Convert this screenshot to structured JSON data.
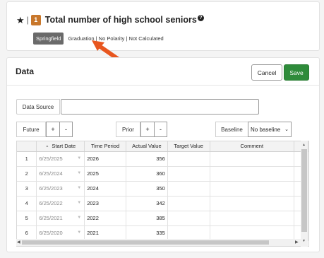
{
  "header": {
    "star_glyph": "★",
    "separator": "|",
    "number_badge": "1",
    "title": "Total number of high school seniors",
    "help_glyph": "?",
    "location_badge": "Springfield",
    "meta_text": "Graduation | No Polarity | Not Calculated"
  },
  "data_section": {
    "title": "Data",
    "cancel_label": "Cancel",
    "save_label": "Save",
    "data_source_label": "Data Source",
    "data_source_value": "",
    "future_label": "Future",
    "prior_label": "Prior",
    "plus_label": "+",
    "minus_label": "-",
    "baseline_label": "Baseline",
    "baseline_value": "No baseline"
  },
  "table": {
    "headers": [
      "",
      "Start Date",
      "Time Period",
      "Actual Value",
      "Target Value",
      "Comment"
    ],
    "rows": [
      {
        "idx": "1",
        "start_date": "6/25/2025",
        "time_period": "2026",
        "actual": "356",
        "target": "",
        "comment": ""
      },
      {
        "idx": "2",
        "start_date": "6/25/2024",
        "time_period": "2025",
        "actual": "360",
        "target": "",
        "comment": ""
      },
      {
        "idx": "3",
        "start_date": "6/25/2023",
        "time_period": "2024",
        "actual": "350",
        "target": "",
        "comment": ""
      },
      {
        "idx": "4",
        "start_date": "6/25/2022",
        "time_period": "2023",
        "actual": "342",
        "target": "",
        "comment": ""
      },
      {
        "idx": "5",
        "start_date": "6/25/2021",
        "time_period": "2022",
        "actual": "385",
        "target": "",
        "comment": ""
      },
      {
        "idx": "6",
        "start_date": "6/25/2020",
        "time_period": "2021",
        "actual": "335",
        "target": "",
        "comment": ""
      }
    ]
  },
  "colors": {
    "number_badge": "#c8772b",
    "save_button": "#2e8b3a",
    "location_badge": "#6a6a6a",
    "arrow": "#e8561f"
  }
}
